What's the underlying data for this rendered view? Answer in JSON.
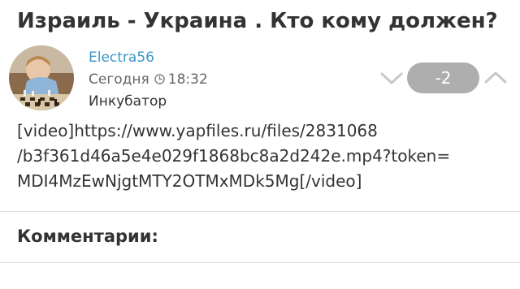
{
  "post": {
    "title": "Израиль - Украина . Кто кому должен?",
    "author": "Electra56",
    "date": "Сегодня",
    "time": "18:32",
    "category": "Инкубатор",
    "rating": "-2",
    "body_lines": [
      "[video]https://www.yapfiles.ru/files/2831068",
      "/b3f361d46a5e4e029f1868bc8a2d242e.mp4?token=",
      "MDI4MzEwNjgtMTY2OTMxMDk5Mg[/video]"
    ]
  },
  "comments": {
    "heading": "Комментарии:"
  },
  "colors": {
    "author_link": "#3a98c9",
    "rating_badge": "#aeaeae",
    "divider": "#dcdcdc"
  },
  "icons": {
    "clock": "clock-icon",
    "vote_down": "chevron-down-icon",
    "vote_up": "chevron-up-icon"
  }
}
